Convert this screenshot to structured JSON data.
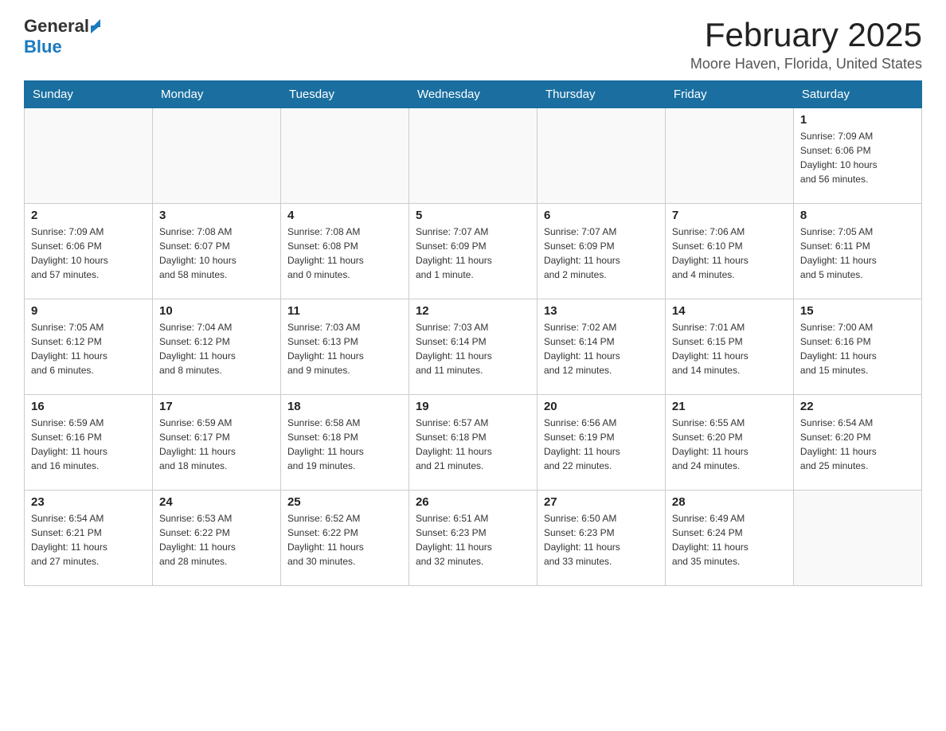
{
  "header": {
    "logo_general": "General",
    "logo_blue": "Blue",
    "title": "February 2025",
    "subtitle": "Moore Haven, Florida, United States"
  },
  "days_of_week": [
    "Sunday",
    "Monday",
    "Tuesday",
    "Wednesday",
    "Thursday",
    "Friday",
    "Saturday"
  ],
  "weeks": [
    [
      {
        "day": "",
        "info": ""
      },
      {
        "day": "",
        "info": ""
      },
      {
        "day": "",
        "info": ""
      },
      {
        "day": "",
        "info": ""
      },
      {
        "day": "",
        "info": ""
      },
      {
        "day": "",
        "info": ""
      },
      {
        "day": "1",
        "info": "Sunrise: 7:09 AM\nSunset: 6:06 PM\nDaylight: 10 hours\nand 56 minutes."
      }
    ],
    [
      {
        "day": "2",
        "info": "Sunrise: 7:09 AM\nSunset: 6:06 PM\nDaylight: 10 hours\nand 57 minutes."
      },
      {
        "day": "3",
        "info": "Sunrise: 7:08 AM\nSunset: 6:07 PM\nDaylight: 10 hours\nand 58 minutes."
      },
      {
        "day": "4",
        "info": "Sunrise: 7:08 AM\nSunset: 6:08 PM\nDaylight: 11 hours\nand 0 minutes."
      },
      {
        "day": "5",
        "info": "Sunrise: 7:07 AM\nSunset: 6:09 PM\nDaylight: 11 hours\nand 1 minute."
      },
      {
        "day": "6",
        "info": "Sunrise: 7:07 AM\nSunset: 6:09 PM\nDaylight: 11 hours\nand 2 minutes."
      },
      {
        "day": "7",
        "info": "Sunrise: 7:06 AM\nSunset: 6:10 PM\nDaylight: 11 hours\nand 4 minutes."
      },
      {
        "day": "8",
        "info": "Sunrise: 7:05 AM\nSunset: 6:11 PM\nDaylight: 11 hours\nand 5 minutes."
      }
    ],
    [
      {
        "day": "9",
        "info": "Sunrise: 7:05 AM\nSunset: 6:12 PM\nDaylight: 11 hours\nand 6 minutes."
      },
      {
        "day": "10",
        "info": "Sunrise: 7:04 AM\nSunset: 6:12 PM\nDaylight: 11 hours\nand 8 minutes."
      },
      {
        "day": "11",
        "info": "Sunrise: 7:03 AM\nSunset: 6:13 PM\nDaylight: 11 hours\nand 9 minutes."
      },
      {
        "day": "12",
        "info": "Sunrise: 7:03 AM\nSunset: 6:14 PM\nDaylight: 11 hours\nand 11 minutes."
      },
      {
        "day": "13",
        "info": "Sunrise: 7:02 AM\nSunset: 6:14 PM\nDaylight: 11 hours\nand 12 minutes."
      },
      {
        "day": "14",
        "info": "Sunrise: 7:01 AM\nSunset: 6:15 PM\nDaylight: 11 hours\nand 14 minutes."
      },
      {
        "day": "15",
        "info": "Sunrise: 7:00 AM\nSunset: 6:16 PM\nDaylight: 11 hours\nand 15 minutes."
      }
    ],
    [
      {
        "day": "16",
        "info": "Sunrise: 6:59 AM\nSunset: 6:16 PM\nDaylight: 11 hours\nand 16 minutes."
      },
      {
        "day": "17",
        "info": "Sunrise: 6:59 AM\nSunset: 6:17 PM\nDaylight: 11 hours\nand 18 minutes."
      },
      {
        "day": "18",
        "info": "Sunrise: 6:58 AM\nSunset: 6:18 PM\nDaylight: 11 hours\nand 19 minutes."
      },
      {
        "day": "19",
        "info": "Sunrise: 6:57 AM\nSunset: 6:18 PM\nDaylight: 11 hours\nand 21 minutes."
      },
      {
        "day": "20",
        "info": "Sunrise: 6:56 AM\nSunset: 6:19 PM\nDaylight: 11 hours\nand 22 minutes."
      },
      {
        "day": "21",
        "info": "Sunrise: 6:55 AM\nSunset: 6:20 PM\nDaylight: 11 hours\nand 24 minutes."
      },
      {
        "day": "22",
        "info": "Sunrise: 6:54 AM\nSunset: 6:20 PM\nDaylight: 11 hours\nand 25 minutes."
      }
    ],
    [
      {
        "day": "23",
        "info": "Sunrise: 6:54 AM\nSunset: 6:21 PM\nDaylight: 11 hours\nand 27 minutes."
      },
      {
        "day": "24",
        "info": "Sunrise: 6:53 AM\nSunset: 6:22 PM\nDaylight: 11 hours\nand 28 minutes."
      },
      {
        "day": "25",
        "info": "Sunrise: 6:52 AM\nSunset: 6:22 PM\nDaylight: 11 hours\nand 30 minutes."
      },
      {
        "day": "26",
        "info": "Sunrise: 6:51 AM\nSunset: 6:23 PM\nDaylight: 11 hours\nand 32 minutes."
      },
      {
        "day": "27",
        "info": "Sunrise: 6:50 AM\nSunset: 6:23 PM\nDaylight: 11 hours\nand 33 minutes."
      },
      {
        "day": "28",
        "info": "Sunrise: 6:49 AM\nSunset: 6:24 PM\nDaylight: 11 hours\nand 35 minutes."
      },
      {
        "day": "",
        "info": ""
      }
    ]
  ]
}
